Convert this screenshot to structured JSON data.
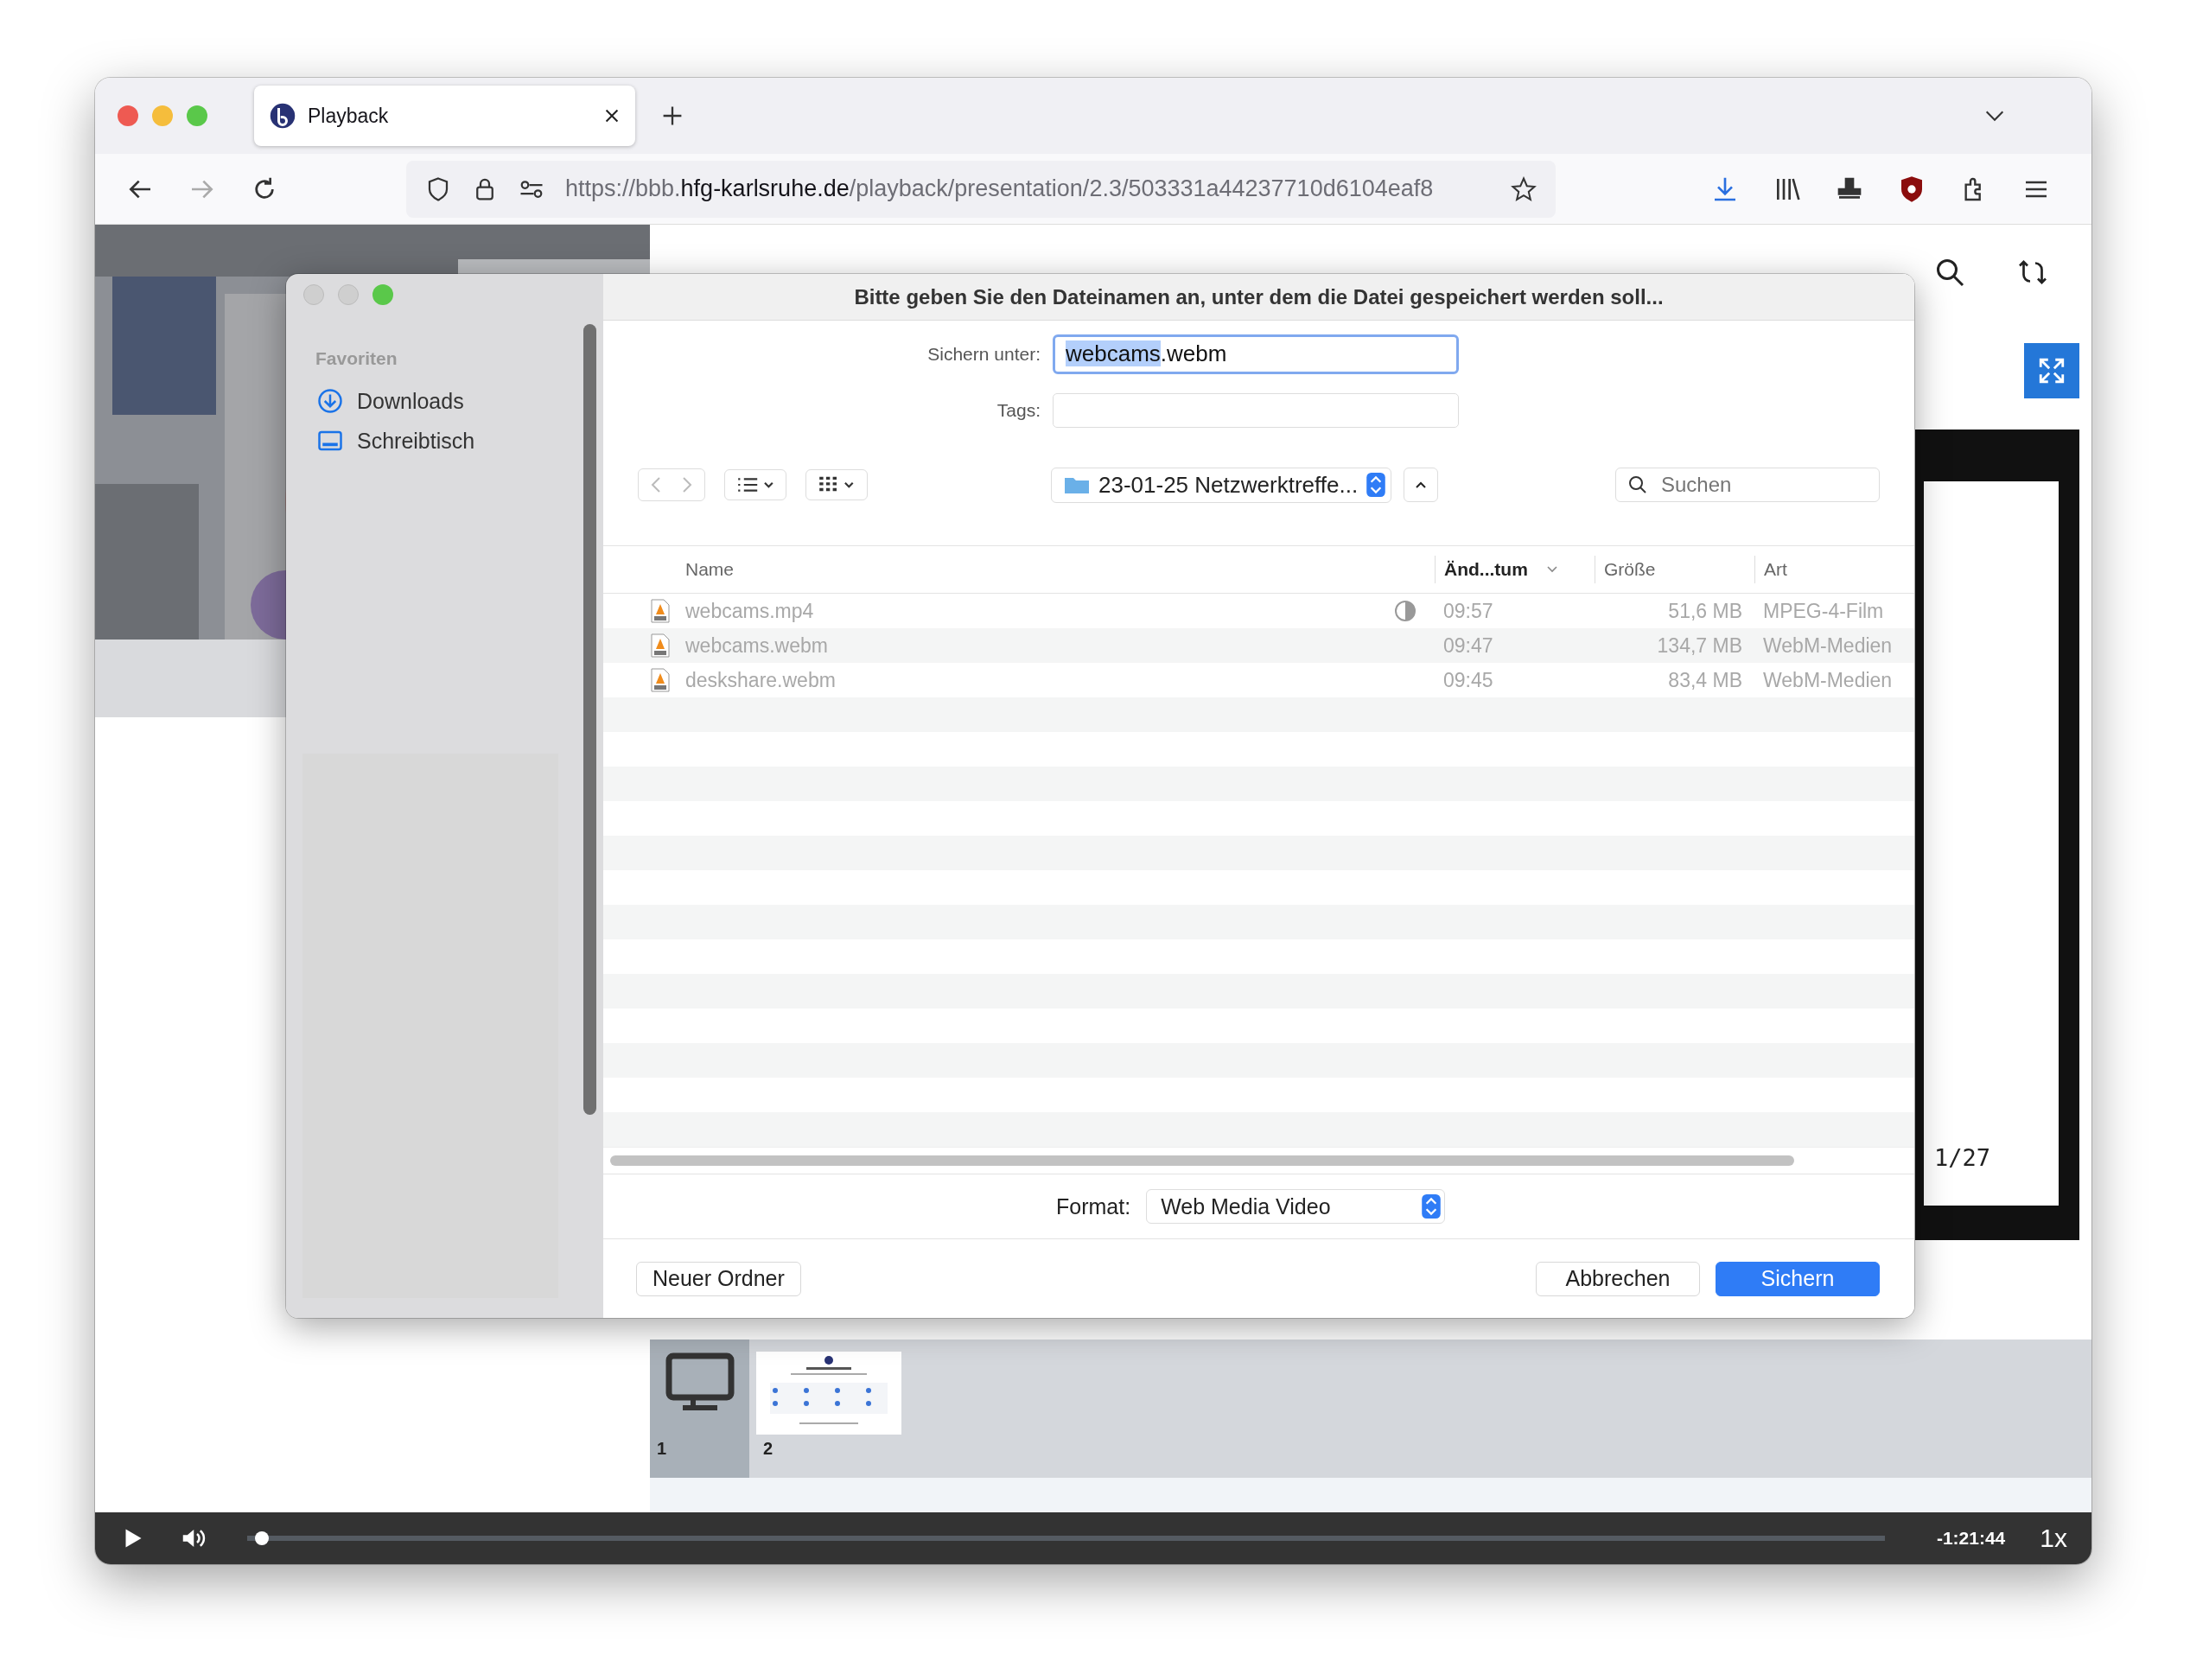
{
  "browser": {
    "tabs": [
      {
        "title": "Playback",
        "selected": true
      }
    ],
    "url": {
      "scheme": "https://bbb.",
      "host": "hfg-karlsruhe.de",
      "path": "/playback/presentation/2.3/503331a44237710d6104eaf8"
    }
  },
  "presentation": {
    "page_counter": "1/27",
    "thumbnails": [
      {
        "label": "1",
        "kind": "screen",
        "selected": true
      },
      {
        "label": "2",
        "kind": "slide",
        "selected": false
      }
    ]
  },
  "player": {
    "progress": {
      "level": 0.005
    },
    "time": "-1:21:44",
    "speed": "1x"
  },
  "dialog": {
    "title": "Bitte geben Sie den Dateinamen an, unter dem die Datei gespeichert werden soll...",
    "sidebar": {
      "heading": "Favoriten",
      "items": [
        {
          "label": "Downloads",
          "kind": "download"
        },
        {
          "label": "Schreibtisch",
          "kind": "desktop"
        }
      ]
    },
    "save_as": {
      "label": "Sichern unter:",
      "value": [
        {
          "text": "webcams",
          "selected": true
        },
        {
          "text": ".webm",
          "selected": false
        }
      ]
    },
    "tags": {
      "label": "Tags:"
    },
    "location": "23-01-25 Netzwerktreffe...",
    "search": {
      "placeholder": "Suchen"
    },
    "columns": [
      {
        "label": "Name",
        "sorted": false
      },
      {
        "label": "Änd...tum",
        "sorted": true
      },
      {
        "label": "Größe",
        "sorted": false
      },
      {
        "label": "Art",
        "sorted": false
      }
    ],
    "files": [
      {
        "name": "webcams.mp4",
        "partial": true,
        "date": "09:57",
        "size": "51,6 MB",
        "type": "MPEG-4-Film",
        "disabled": true
      },
      {
        "name": "webcams.webm",
        "partial": false,
        "date": "09:47",
        "size": "134,7 MB",
        "type": "WebM-Medien",
        "disabled": true
      },
      {
        "name": "deskshare.webm",
        "partial": false,
        "date": "09:45",
        "size": "83,4 MB",
        "type": "WebM-Medien",
        "disabled": true
      }
    ],
    "format": {
      "label": "Format:",
      "value": "Web Media Video"
    },
    "buttons": [
      {
        "label": "Neuer Ordner",
        "kind": "new-folder"
      },
      {
        "label": "Abbrechen",
        "kind": "cancel"
      },
      {
        "label": "Sichern",
        "kind": "default"
      }
    ]
  }
}
